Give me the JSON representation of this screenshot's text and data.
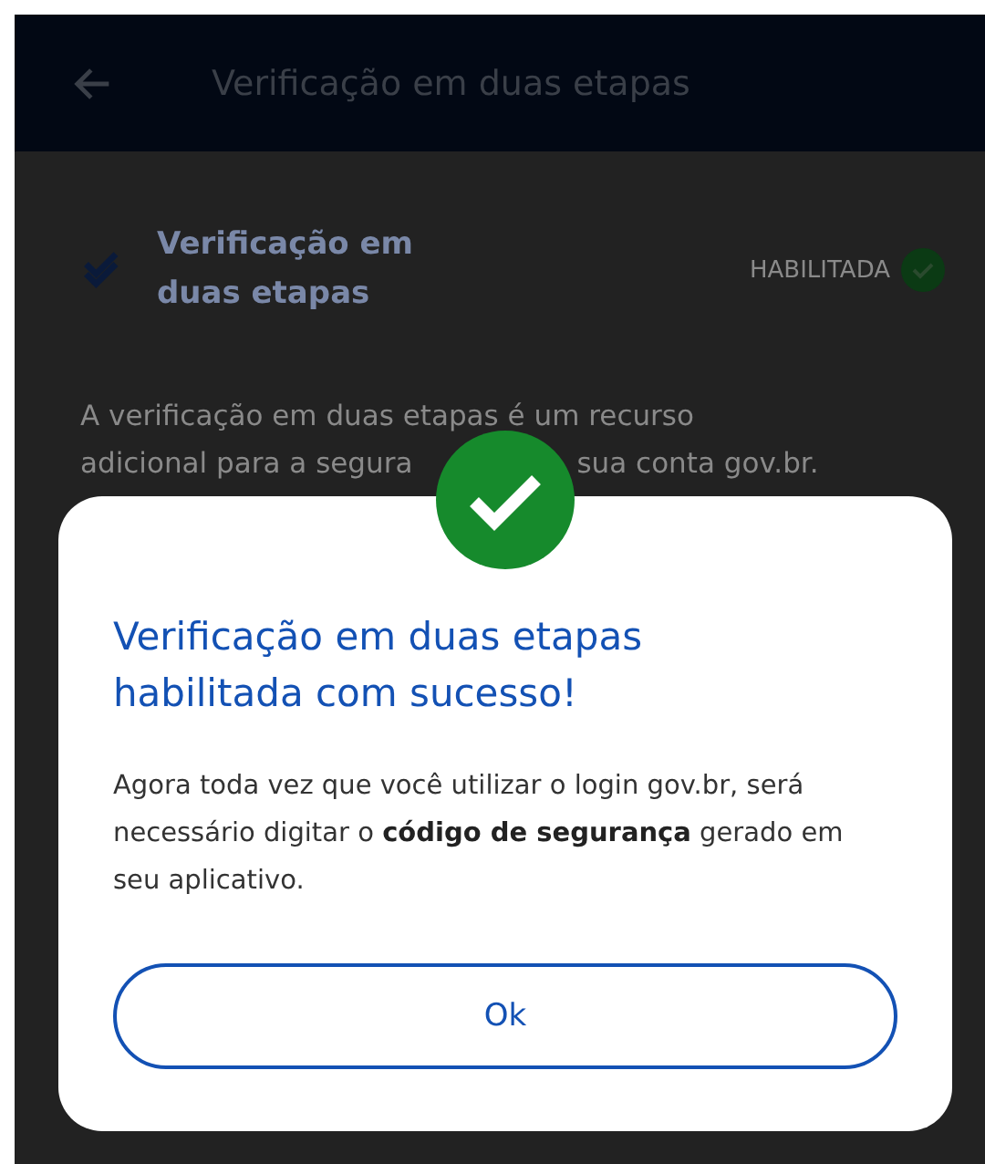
{
  "app_bar": {
    "title": "Verificação em duas etapas"
  },
  "setting": {
    "title": "Verificação em duas etapas",
    "status": "HABILITADA",
    "enabled": true
  },
  "description": {
    "line_1": "A verificação em duas etapas é um recurso",
    "line_2_start": "adicional para a segura",
    "line_2_end": "sua conta gov.br."
  },
  "dialog": {
    "title": "Verificação em duas etapas habilitada com sucesso!",
    "message": "Agora toda vez que você utilizar o login gov.br, será necessário digitar o **código de segurança** gerado em seu aplicativo.",
    "button": "Ok"
  }
}
